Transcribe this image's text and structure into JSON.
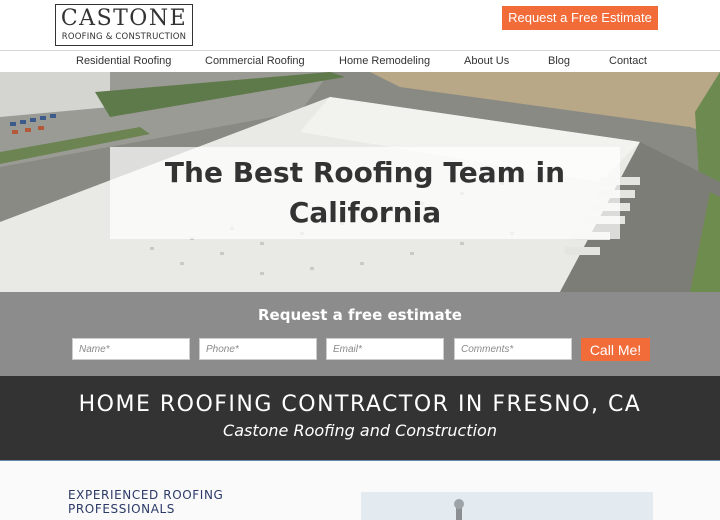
{
  "header": {
    "logo_main": "CASTONE",
    "logo_sub": "ROOFING & CONSTRUCTION",
    "cta_label": "Request a Free Estimate"
  },
  "nav": {
    "items": [
      "Residential Roofing",
      "Commercial Roofing",
      "Home Remodeling",
      "About Us",
      "Blog",
      "Contact"
    ]
  },
  "hero": {
    "title_line1": "The Best Roofing Team in",
    "title_line2": "California"
  },
  "estimate": {
    "title": "Request a free estimate",
    "name_placeholder": "Name*",
    "phone_placeholder": "Phone*",
    "email_placeholder": "Email*",
    "comments_placeholder": "Comments*",
    "submit_label": "Call Me!"
  },
  "band": {
    "title": "HOME ROOFING CONTRACTOR IN FRESNO, CA",
    "subtitle": "Castone Roofing and Construction"
  },
  "lower": {
    "heading_line1": "EXPERIENCED ROOFING",
    "heading_line2": "PROFESSIONALS"
  },
  "colors": {
    "accent": "#f26c3a",
    "dark_band": "#333333",
    "estimate_bg": "#8c8c8c",
    "heading_navy": "#2b3a67"
  }
}
